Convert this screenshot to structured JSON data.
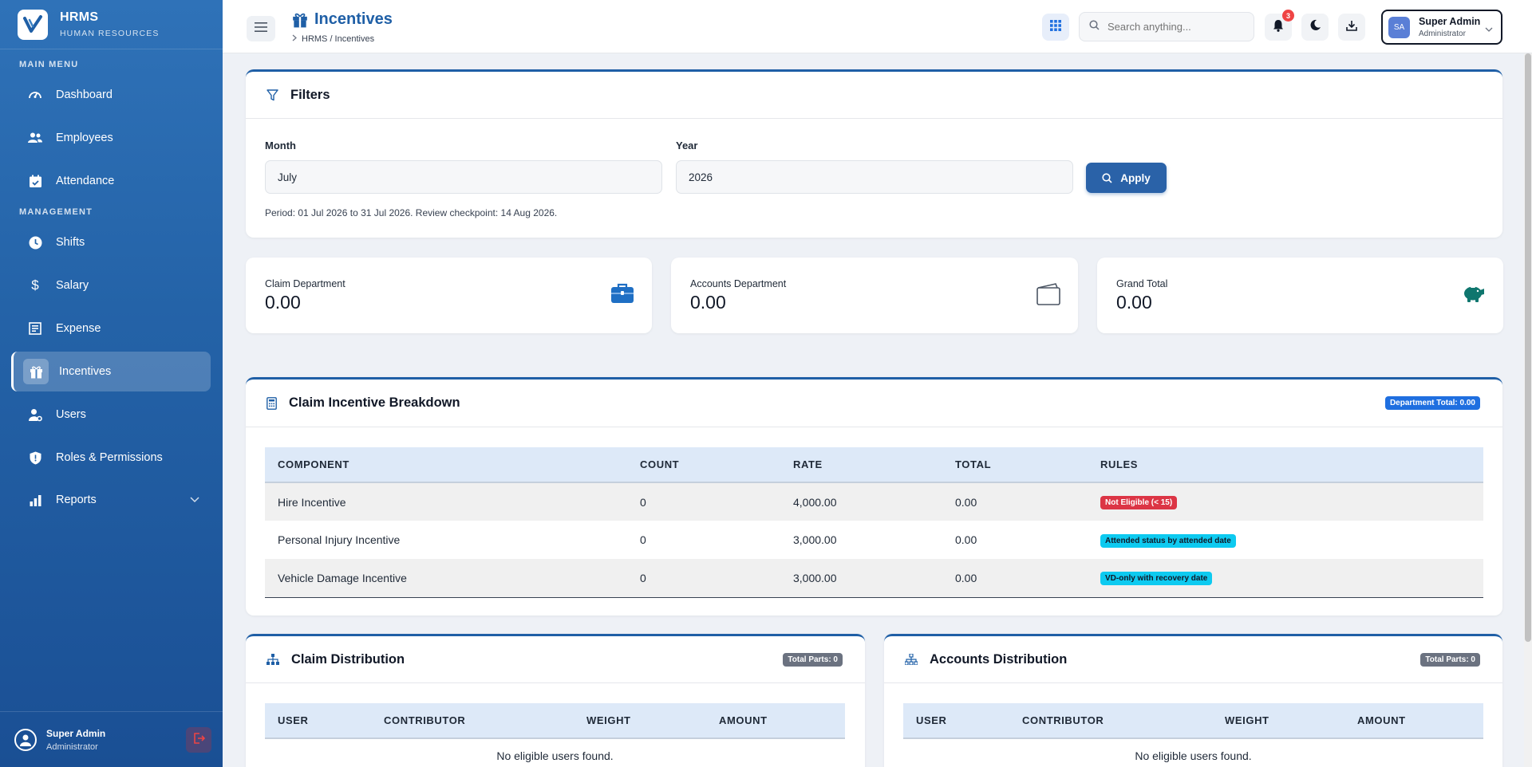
{
  "brand": {
    "title": "HRMS",
    "subtitle": "HUMAN RESOURCES"
  },
  "sidebar": {
    "section_main": "MAIN MENU",
    "section_management": "MANAGEMENT",
    "items": [
      {
        "label": "Dashboard",
        "icon": "dashboard-gauge-icon"
      },
      {
        "label": "Employees",
        "icon": "people-icon"
      },
      {
        "label": "Attendance",
        "icon": "calendar-check-icon"
      },
      {
        "label": "Shifts",
        "icon": "clock-icon"
      },
      {
        "label": "Salary",
        "icon": "dollar-icon"
      },
      {
        "label": "Expense",
        "icon": "receipt-icon"
      },
      {
        "label": "Incentives",
        "icon": "gift-icon",
        "active": true
      },
      {
        "label": "Users",
        "icon": "user-gear-icon"
      },
      {
        "label": "Roles & Permissions",
        "icon": "shield-icon"
      },
      {
        "label": "Reports",
        "icon": "bar-chart-icon"
      }
    ],
    "footer": {
      "name": "Super Admin",
      "role": "Administrator"
    }
  },
  "header": {
    "title": "Incentives",
    "breadcrumb": "HRMS / Incentives",
    "search_placeholder": "Search anything...",
    "notification_count": "3",
    "user": {
      "initials": "SA",
      "name": "Super Admin",
      "role": "Administrator"
    }
  },
  "filters": {
    "title": "Filters",
    "month_label": "Month",
    "month_value": "July",
    "year_label": "Year",
    "year_value": "2026",
    "apply_label": "Apply",
    "period_note": "Period: 01 Jul 2026 to 31 Jul 2026. Review checkpoint: 14 Aug 2026."
  },
  "stats": [
    {
      "label": "Claim Department",
      "value": "0.00",
      "icon": "briefcase-icon",
      "color": "#1f6fc4"
    },
    {
      "label": "Accounts Department",
      "value": "0.00",
      "icon": "wallet-icon",
      "color": "#4b5563"
    },
    {
      "label": "Grand Total",
      "value": "0.00",
      "icon": "piggy-bank-icon",
      "color": "#0f766e"
    }
  ],
  "breakdown": {
    "title": "Claim Incentive Breakdown",
    "badge": "Department Total: 0.00",
    "columns": [
      "COMPONENT",
      "COUNT",
      "RATE",
      "TOTAL",
      "RULES"
    ],
    "rows": [
      {
        "component": "Hire Incentive",
        "count": "0",
        "rate": "4,000.00",
        "total": "0.00",
        "rule": "Not Eligible (< 15)",
        "rule_color": "red"
      },
      {
        "component": "Personal Injury Incentive",
        "count": "0",
        "rate": "3,000.00",
        "total": "0.00",
        "rule": "Attended status by attended date",
        "rule_color": "cyan"
      },
      {
        "component": "Vehicle Damage Incentive",
        "count": "0",
        "rate": "3,000.00",
        "total": "0.00",
        "rule": "VD-only with recovery date",
        "rule_color": "cyan"
      }
    ]
  },
  "claim_distribution": {
    "title": "Claim Distribution",
    "badge": "Total Parts: 0",
    "columns": [
      "USER",
      "CONTRIBUTOR",
      "WEIGHT",
      "AMOUNT"
    ],
    "empty": "No eligible users found."
  },
  "accounts_distribution": {
    "title": "Accounts Distribution",
    "badge": "Total Parts: 0",
    "columns": [
      "USER",
      "CONTRIBUTOR",
      "WEIGHT",
      "AMOUNT"
    ],
    "empty": "No eligible users found."
  },
  "colors": {
    "primary": "#1f5fa6",
    "sidebar": "#2463a8",
    "danger": "#dc3545",
    "info": "#0dcaf0"
  }
}
